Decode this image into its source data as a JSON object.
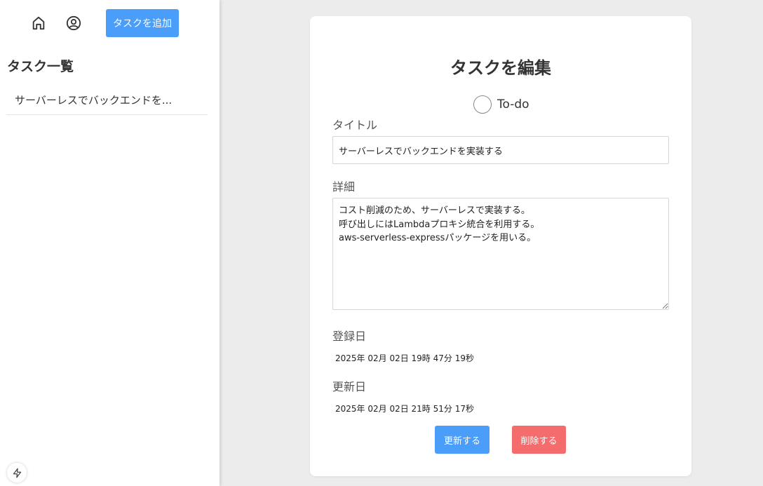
{
  "sidebar": {
    "home_icon": "home-icon",
    "account_icon": "user-circle-icon",
    "add_button_label": "タスクを追加",
    "list_title": "タスク一覧",
    "tasks": [
      {
        "label": "サーバーレスでバックエンドを..."
      }
    ],
    "footer_icon": "bolt-icon"
  },
  "editor": {
    "title": "タスクを編集",
    "status_label": "To-do",
    "title_field_label": "タイトル",
    "title_value": "サーバーレスでバックエンドを実装する",
    "detail_field_label": "詳細",
    "detail_value": "コスト削減のため、サーバーレスで実装する。\n呼び出しにはLambdaプロキシ統合を利用する。\naws-serverless-expressパッケージを用いる。",
    "created_label": "登録日",
    "created_value": "2025年 02月 02日 19時 47分 19秒",
    "updated_label": "更新日",
    "updated_value": "2025年 02月 02日 21時 51分 17秒",
    "update_button": "更新する",
    "delete_button": "削除する"
  },
  "colors": {
    "primary": "#4a9df8",
    "danger": "#f46c6c",
    "background": "#ececec"
  }
}
